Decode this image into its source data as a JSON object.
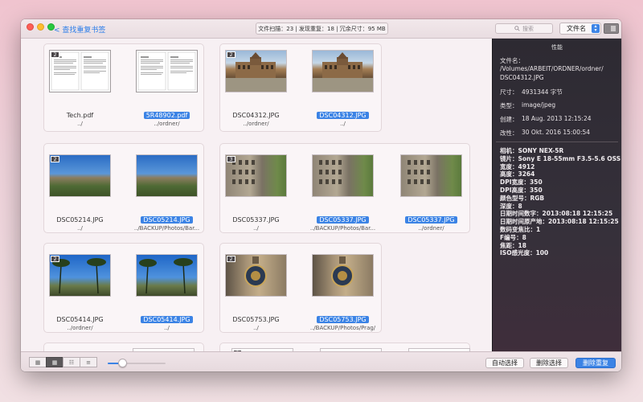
{
  "titlebar": {
    "back_label": "< 查找重复书签",
    "stats": "文件扫描：23 | 发现重复：18 | 冗余尺寸：95 MB",
    "search_placeholder": "搜索",
    "sort_label": "文件名"
  },
  "groups": [
    {
      "items": [
        {
          "name": "Tech.pdf",
          "path": "../",
          "selected": false,
          "badge": "2",
          "thumb": "pdf"
        },
        {
          "name": "5R48902.pdf",
          "path": "../ordner/",
          "selected": true,
          "badge": "",
          "thumb": "pdf"
        }
      ]
    },
    {
      "items": [
        {
          "name": "DSC04312.JPG",
          "path": "../ordner/",
          "selected": false,
          "badge": "2",
          "thumb": "palace"
        },
        {
          "name": "DSC04312.JPG",
          "path": "../",
          "selected": true,
          "badge": "",
          "thumb": "palace"
        }
      ]
    },
    {
      "items": [
        {
          "name": "DSC05214.JPG",
          "path": "../",
          "selected": false,
          "badge": "2",
          "thumb": "city"
        },
        {
          "name": "DSC05214.JPG",
          "path": "../BACKUP/Photos/Bar...",
          "selected": true,
          "badge": "",
          "thumb": "city"
        }
      ]
    },
    {
      "items": [
        {
          "name": "DSC05337.JPG",
          "path": "../",
          "selected": false,
          "badge": "3",
          "thumb": "facade"
        },
        {
          "name": "DSC05337.JPG",
          "path": "../BACKUP/Photos/Bar...",
          "selected": true,
          "badge": "",
          "thumb": "facade"
        },
        {
          "name": "DSC05337.JPG",
          "path": "../ordner/",
          "selected": true,
          "badge": "",
          "thumb": "facade"
        }
      ]
    },
    {
      "items": [
        {
          "name": "DSC05414.JPG",
          "path": "../ordner/",
          "selected": false,
          "badge": "2",
          "thumb": "palms"
        },
        {
          "name": "DSC05414.JPG",
          "path": "../",
          "selected": true,
          "badge": "",
          "thumb": "palms"
        }
      ]
    },
    {
      "items": [
        {
          "name": "DSC05753.JPG",
          "path": "../",
          "selected": false,
          "badge": "2",
          "thumb": "clock"
        },
        {
          "name": "DSC05753.JPG",
          "path": "../BACKUP/Photos/Prag/",
          "selected": true,
          "badge": "",
          "thumb": "clock"
        }
      ]
    },
    {
      "items": [
        {
          "name": "",
          "path": "",
          "selected": false,
          "badge": "",
          "thumb": "doc"
        }
      ]
    },
    {
      "items": [
        {
          "name": "",
          "path": "",
          "selected": false,
          "badge": "3",
          "thumb": "doc"
        },
        {
          "name": "",
          "path": "",
          "selected": false,
          "badge": "",
          "thumb": "doc"
        },
        {
          "name": "",
          "path": "",
          "selected": false,
          "badge": "",
          "thumb": "doc"
        }
      ]
    }
  ],
  "sidebar": {
    "heading": "性能",
    "file_name_label": "文件名：",
    "file_path_line1": "/Volumes/ARBEIT/ORDNER/ordner/",
    "file_path_line2": "DSC04312.JPG",
    "size_label": "尺寸：",
    "size_value": "4931344 字节",
    "type_label": "类型：",
    "type_value": "image/jpeg",
    "created_label": "创建：",
    "created_value": "18 Aug. 2013 12:15:24",
    "modified_label": "改性：",
    "modified_value": "30 Okt. 2016 15:00:54",
    "exif": [
      "相机：SONY NEX-5R",
      "镜片：Sony E 18-55mm F3.5-5.6 OSS",
      "宽度：4912",
      "高度：3264",
      "DPI宽度：350",
      "DPI高度：350",
      "颜色型号：RGB",
      "深度：8",
      "日期时间数字：2013:08:18 12:15:25",
      "日期时间原产地：2013:08:18 12:15:25",
      "数码变焦比：1",
      "F编号：8",
      "焦距：18",
      "ISO感光度：100"
    ]
  },
  "bottombar": {
    "auto_select": "自动选择",
    "deselect": "删除选择",
    "delete_dups": "删除重复",
    "zoom_level": 0.25
  },
  "colors": {
    "accent": "#3b83e5",
    "sidebar_bg": "#2d2a32"
  }
}
